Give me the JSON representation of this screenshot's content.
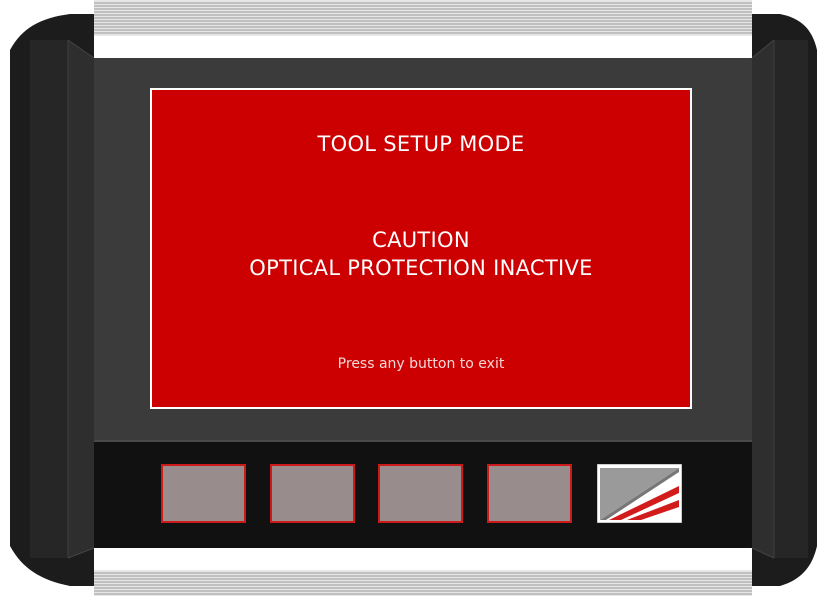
{
  "screen": {
    "title": "TOOL SETUP MODE",
    "caution_line1": "CAUTION",
    "caution_line2": "OPTICAL PROTECTION INACTIVE",
    "hint": "Press any button to exit",
    "background_color": "#cc0000"
  },
  "softkeys": {
    "count": 4,
    "face_color": "#988c8c",
    "border_color": "#cc1a1a"
  },
  "logo_button": {
    "icon": "brand-stripes-logo-icon"
  },
  "device": {
    "body_color": "#3a3a3a",
    "rail_color": "#ffffff"
  }
}
